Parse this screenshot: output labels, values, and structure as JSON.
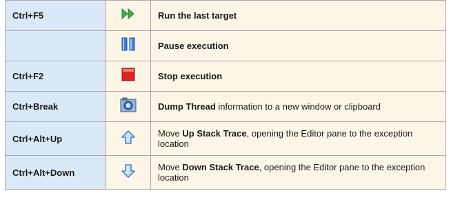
{
  "rows": [
    {
      "shortcut": "Ctrl+F5",
      "icon": "run-icon",
      "description": "Run the last target"
    },
    {
      "shortcut": "",
      "icon": "pause-icon",
      "description": "Pause execution"
    },
    {
      "shortcut": "Ctrl+F2",
      "icon": "stop-icon",
      "description": "Stop execution"
    },
    {
      "shortcut": "Ctrl+Break",
      "icon": "camera-icon",
      "description_bold": "Dump Thread",
      "description_rest": " information to a new window or clipboard"
    },
    {
      "shortcut": "Ctrl+Alt+Up",
      "icon": "arrow-up-icon",
      "description_pre": "Move ",
      "description_bold": "Up Stack Trace",
      "description_rest": ", opening the Editor pane to the exception location"
    },
    {
      "shortcut": "Ctrl+Alt+Down",
      "icon": "arrow-down-icon",
      "description_pre": "Move ",
      "description_bold": "Down Stack Trace",
      "description_rest": ", opening the Editor pane to the exception location"
    }
  ],
  "colors": {
    "key_bg": "#d9e9f7",
    "desc_bg": "#fdf6e6",
    "border": "#a9a9a9",
    "run_green": "#3bb34a",
    "pause_blue": "#3f7fd6",
    "stop_red": "#e02323",
    "arrow_blue": "#3f86d8"
  }
}
